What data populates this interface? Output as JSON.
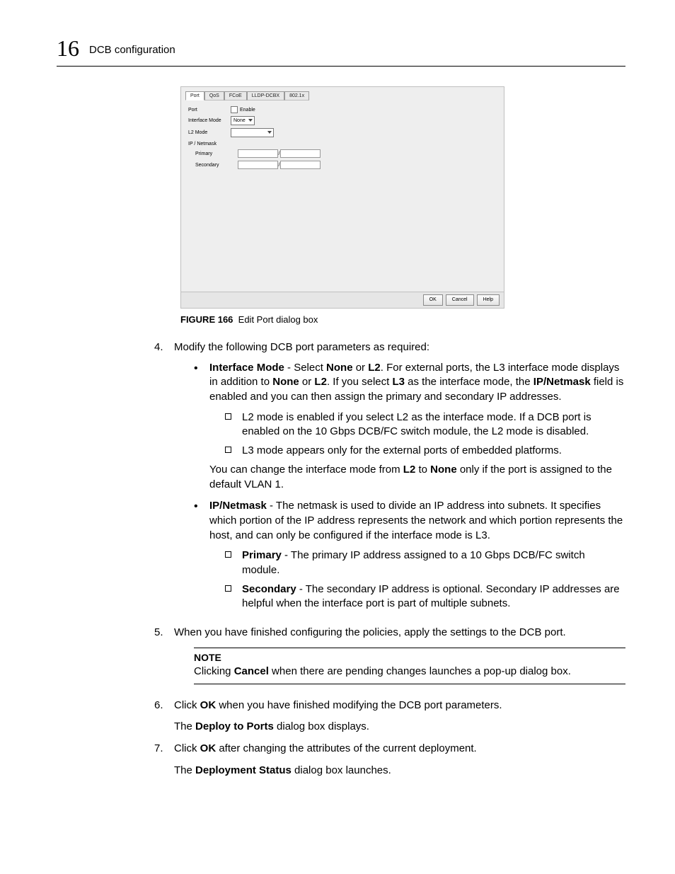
{
  "header": {
    "chapter": "16",
    "title": "DCB configuration"
  },
  "screenshot": {
    "tabs": [
      "Port",
      "QoS",
      "FCoE",
      "LLDP-DCBX",
      "802.1x"
    ],
    "labels": {
      "port": "Port",
      "interface_mode": "Interface Mode",
      "l2_mode": "L2 Mode",
      "ip_netmask": "IP / Netmask",
      "primary": "Primary",
      "secondary": "Secondary",
      "enable": "Enable",
      "none": "None"
    },
    "buttons": {
      "ok": "OK",
      "cancel": "Cancel",
      "help": "Help"
    }
  },
  "figure": {
    "label": "FIGURE 166",
    "caption": "Edit Port dialog box"
  },
  "steps": {
    "s4": {
      "num": "4.",
      "text": "Modify the following DCB port parameters as required:",
      "bullets": {
        "b1": {
          "lead_bold": "Interface Mode",
          "text_a": " - Select ",
          "none": "None",
          "text_b": " or ",
          "l2": "L2",
          "text_c": ". For external ports, the L3 interface mode displays in addition to ",
          "none2": "None",
          "text_d": " or ",
          "l22": "L2",
          "text_e": ". If you select ",
          "l3": "L3",
          "text_f": " as the interface mode, the ",
          "ipnet": "IP/Netmask",
          "text_g": " field is enabled and you can then assign the primary and secondary IP addresses.",
          "sq1": "L2 mode is enabled if you select L2 as the interface mode. If a DCB port is enabled on the 10 Gbps DCB/FC switch module, the L2 mode is disabled.",
          "sq2": "L3 mode appears only for the external ports of embedded platforms.",
          "after_a": "You can change the interface mode from ",
          "after_l2": "L2",
          "after_b": " to ",
          "after_none": "None",
          "after_c": " only if the port is assigned to the default VLAN 1."
        },
        "b2": {
          "lead_bold": "IP/Netmask",
          "text": " - The netmask is used to divide an IP address into subnets. It specifies which portion of the IP address represents the network and which portion represents the host, and can only be configured if the interface mode is L3.",
          "sq1_bold": "Primary",
          "sq1_text": " - The primary IP address assigned to a 10 Gbps DCB/FC switch module.",
          "sq2_bold": "Secondary",
          "sq2_text": " - The secondary IP address is optional. Secondary IP addresses are helpful when the interface port is part of multiple subnets."
        }
      }
    },
    "s5": {
      "num": "5.",
      "text": "When you have finished configuring the policies, apply the settings to the DCB port.",
      "note_title": "NOTE",
      "note_a": "Clicking ",
      "note_bold": "Cancel",
      "note_b": " when there are pending changes launches a pop-up dialog box."
    },
    "s6": {
      "num": "6.",
      "text_a": "Click ",
      "ok": "OK",
      "text_b": " when you have finished modifying the DCB port parameters.",
      "after_a": "The ",
      "after_bold": "Deploy to Ports",
      "after_b": " dialog box displays."
    },
    "s7": {
      "num": "7.",
      "text_a": "Click ",
      "ok": "OK",
      "text_b": " after changing the attributes of the current deployment.",
      "after_a": "The ",
      "after_bold": "Deployment Status",
      "after_b": " dialog box launches."
    }
  }
}
